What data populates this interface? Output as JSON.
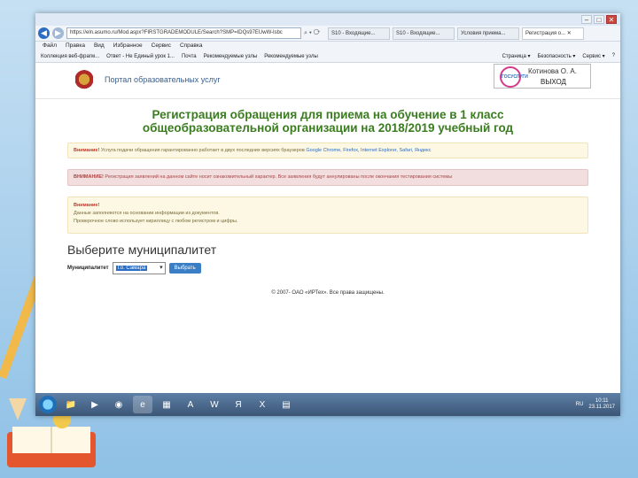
{
  "window": {
    "controls": [
      "–",
      "□",
      "✕"
    ]
  },
  "browser": {
    "address": "https://eln.asumo.ru/Mod.aspx?FIRSTGRADEMODULE/Search?SMP=IDQs97EUwW-lsbc",
    "address_tools": "⌕ ▾ ⟳",
    "tabs": [
      {
        "label": "S10 - Входящие...",
        "active": false
      },
      {
        "label": "S10 - Входящие...",
        "active": false
      },
      {
        "label": "Условия приема...",
        "active": false
      },
      {
        "label": "Регистрация о... ✕",
        "active": true
      }
    ],
    "menu": [
      "Файл",
      "Правка",
      "Вид",
      "Избранное",
      "Сервис",
      "Справка"
    ],
    "favorites": [
      "Коллекция веб-фрагм...",
      "Ответ - Не Единый урок 1...",
      "Почта",
      "Рекомендуемые узлы",
      "Рекомендуемые узлы"
    ],
    "toolbar_right": [
      "Страница ▾",
      "Безопасность ▾",
      "Сервис ▾",
      "?"
    ]
  },
  "portal": {
    "title": "Портал образовательных услуг",
    "logo_text": "ГОСУСЛУГИ",
    "user_name": "Котинова О. А.",
    "logout": "ВЫХОД"
  },
  "page": {
    "heading_line1": "Регистрация обращения для приема на обучение в 1 класс",
    "heading_line2": "общеобразовательной организации на 2018/2019 учебный год",
    "alert1": {
      "bold": "Внимание!",
      "text": " Услуга подачи обращения гарантированно работает в двух последних версиях браузеров ",
      "links": "Google Chrome, Firefox, Internet Explorer, Safari, Яндекс"
    },
    "alert2": {
      "bold": "ВНИМАНИЕ!",
      "text": " Регистрация заявлений на данном сайте носит ознакомительный характер. Все заявления будут аннулированы после окончания тестирования системы"
    },
    "alert3": {
      "bold": "Внимание!",
      "line1": "Данные заполняются на основании информации из документов.",
      "line2": "Проверочное слово использует кириллицу с любом регистром и цифры."
    },
    "muni_heading": "Выберите муниципалитет",
    "muni_label": "Муниципалитет",
    "muni_value": "г.о. Самара",
    "select_button": "Выбрать",
    "footer": "© 2007- ОАО «ИРТех». Все права защищены."
  },
  "taskbar": {
    "apps": [
      "📁",
      "▶",
      "◉",
      "e",
      "▦",
      "A",
      "W",
      "Я",
      "X",
      "▤"
    ],
    "lang": "RU",
    "time": "10:11",
    "date": "23.11.2017"
  }
}
